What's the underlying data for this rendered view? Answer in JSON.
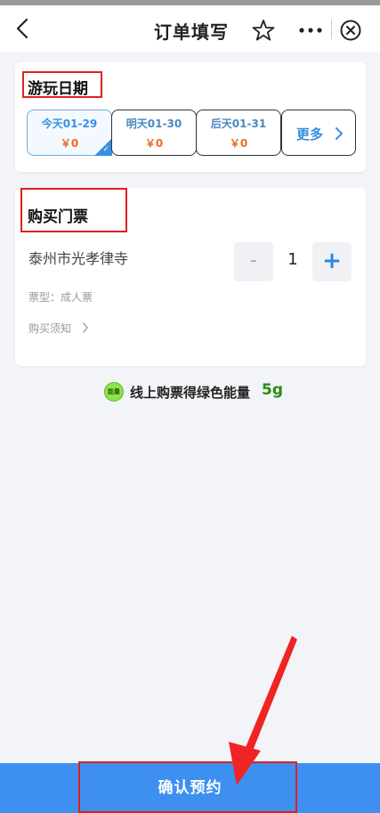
{
  "nav": {
    "title": "订单填写"
  },
  "date_section": {
    "title": "游玩日期",
    "options": [
      {
        "label": "今天01-29",
        "price": "￥0",
        "selected": true
      },
      {
        "label": "明天01-30",
        "price": "￥0",
        "selected": false
      },
      {
        "label": "后天01-31",
        "price": "￥0",
        "selected": false
      }
    ],
    "more_label": "更多"
  },
  "ticket_section": {
    "title": "购买门票",
    "name": "泰州市光孝律寺",
    "minus_label": "-",
    "quantity": "1",
    "plus_label": "+",
    "type_label": "票型：成人票",
    "notice_label": "购买须知"
  },
  "energy": {
    "badge": "能量",
    "text": "线上购票得绿色能量",
    "amount": "5g"
  },
  "footer": {
    "confirm_label": "确认预约"
  },
  "colors": {
    "accent": "#3d8ff0",
    "highlight_red": "#e02020",
    "price_orange": "#ee6a20",
    "energy_green": "#2b8a12"
  },
  "icons": [
    "back-arrow-icon",
    "star-icon",
    "more-dots-icon",
    "close-circle-icon",
    "chevron-right-icon",
    "check-icon",
    "energy-icon"
  ]
}
